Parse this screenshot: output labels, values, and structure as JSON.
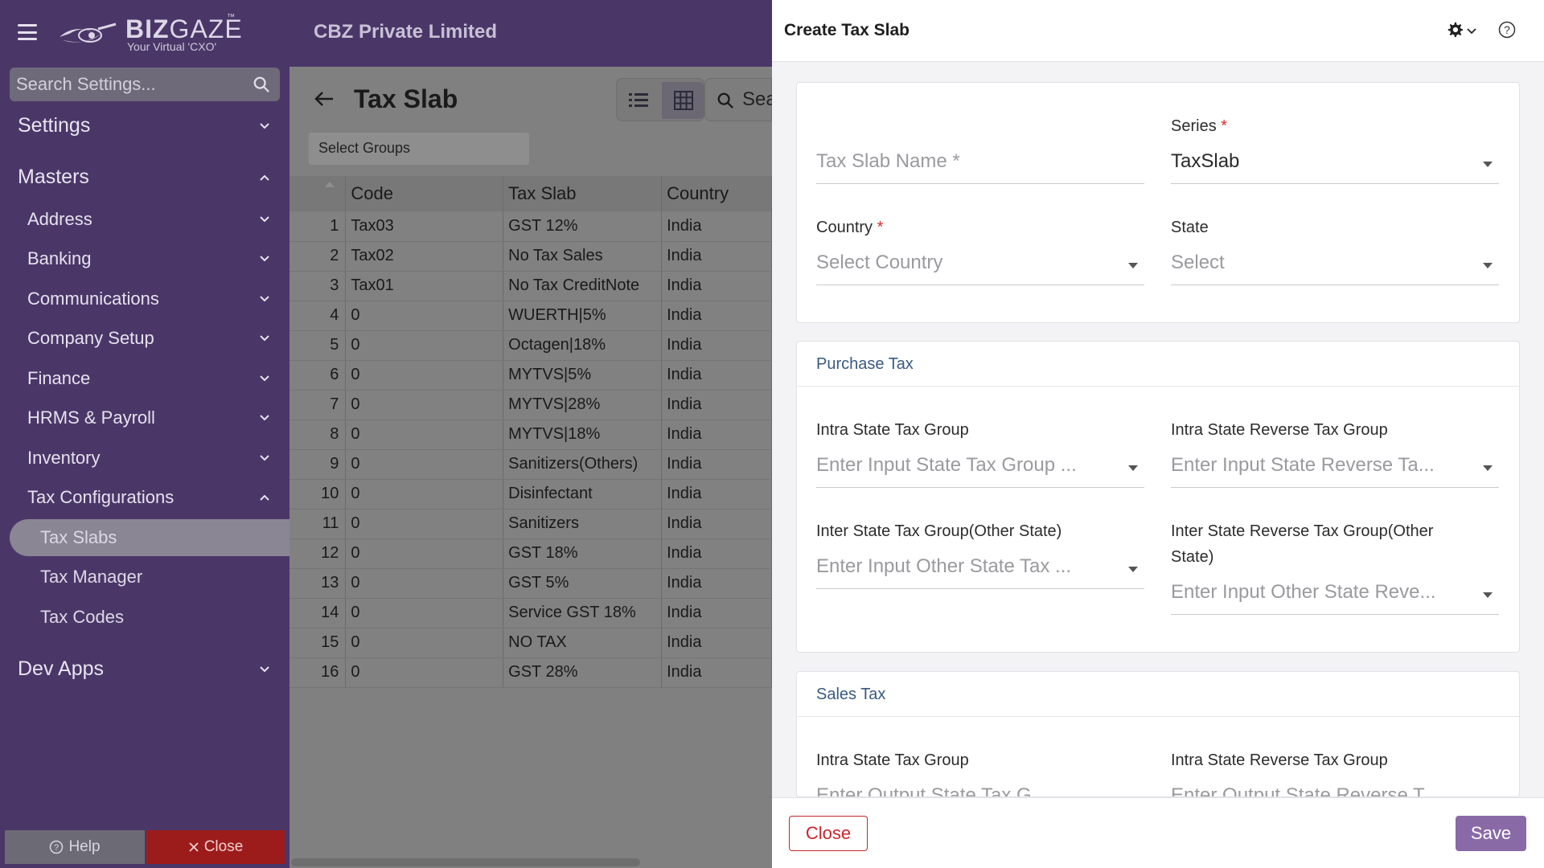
{
  "app": {
    "logo_brand_bold": "BIZ",
    "logo_brand_light": "GAZE",
    "logo_tm": "™",
    "logo_tagline": "Your Virtual 'CXO'",
    "company": "CBZ Private Limited"
  },
  "sidebar": {
    "search_placeholder": "Search Settings...",
    "sections": {
      "settings": "Settings",
      "masters": "Masters",
      "dev_apps": "Dev Apps"
    },
    "masters_items": [
      "Address",
      "Banking",
      "Communications",
      "Company Setup",
      "Finance",
      "HRMS & Payroll",
      "Inventory",
      "Tax Configurations"
    ],
    "tax_sub_items": [
      "Tax Slabs",
      "Tax Manager",
      "Tax Codes"
    ],
    "active_item": "Tax Slabs",
    "help_label": "Help",
    "close_label": "Close"
  },
  "main": {
    "title": "Tax Slab",
    "search_text": "Sea",
    "select_groups": "Select Groups",
    "columns": [
      "Code",
      "Tax Slab",
      "Country"
    ],
    "rows": [
      [
        "1",
        "Tax03",
        "GST 12%",
        "India"
      ],
      [
        "2",
        "Tax02",
        "No Tax Sales",
        "India"
      ],
      [
        "3",
        "Tax01",
        "No Tax CreditNote",
        "India"
      ],
      [
        "4",
        "0",
        "WUERTH|5%",
        "India"
      ],
      [
        "5",
        "0",
        "Octagen|18%",
        "India"
      ],
      [
        "6",
        "0",
        "MYTVS|5%",
        "India"
      ],
      [
        "7",
        "0",
        "MYTVS|28%",
        "India"
      ],
      [
        "8",
        "0",
        "MYTVS|18%",
        "India"
      ],
      [
        "9",
        "0",
        "Sanitizers(Others)",
        "India"
      ],
      [
        "10",
        "0",
        "Disinfectant",
        "India"
      ],
      [
        "11",
        "0",
        "Sanitizers",
        "India"
      ],
      [
        "12",
        "0",
        "GST 18%",
        "India"
      ],
      [
        "13",
        "0",
        "GST 5%",
        "India"
      ],
      [
        "14",
        "0",
        "Service GST 18%",
        "India"
      ],
      [
        "15",
        "0",
        "NO TAX",
        "India"
      ],
      [
        "16",
        "0",
        "GST 28%",
        "India"
      ]
    ]
  },
  "drawer": {
    "title": "Create Tax Slab",
    "general": {
      "tax_slab_name_placeholder": "Tax Slab Name *",
      "series_label": "Series",
      "series_value": "TaxSlab",
      "country_label": "Country",
      "country_placeholder": "Select Country",
      "state_label": "State",
      "state_placeholder": "Select"
    },
    "purchase": {
      "heading": "Purchase Tax",
      "intra_label": "Intra State Tax Group",
      "intra_placeholder": "Enter Input State Tax Group ...",
      "intra_rev_label": "Intra State Reverse Tax Group",
      "intra_rev_placeholder": "Enter Input State Reverse Ta...",
      "inter_label": "Inter State Tax Group(Other State)",
      "inter_placeholder": "Enter Input Other State Tax ...",
      "inter_rev_label_1": "Inter State Reverse Tax Group(Other",
      "inter_rev_label_2": "State)",
      "inter_rev_placeholder": "Enter Input Other State Reve..."
    },
    "sales": {
      "heading": "Sales Tax",
      "intra_label": "Intra State Tax Group",
      "intra_placeholder": "Enter Output State Tax G...",
      "intra_rev_label": "Intra State Reverse Tax Group",
      "intra_rev_placeholder": "Enter Output State Reverse T..."
    },
    "close_label": "Close",
    "save_label": "Save"
  },
  "colors": {
    "sidebar_bg": "#4a3768",
    "accent": "#8a6aa6",
    "danger": "#c8262c",
    "section_heading": "#3a5a80"
  }
}
